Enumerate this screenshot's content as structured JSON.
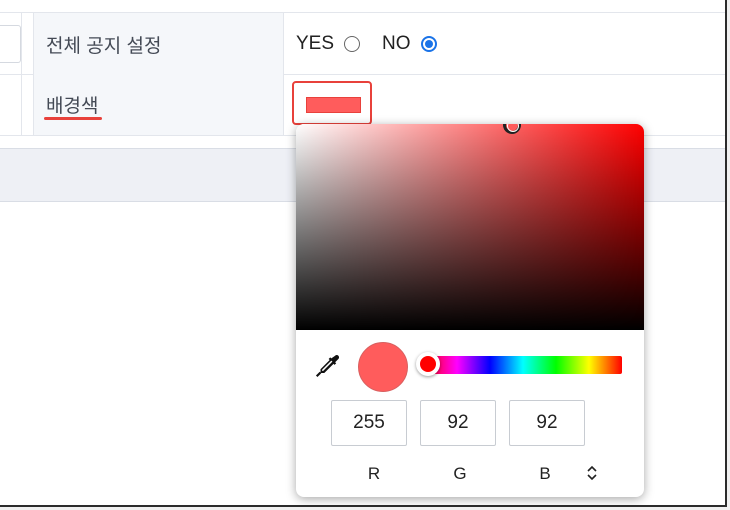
{
  "settings": {
    "row1": {
      "label": "전체 공지 설정",
      "options": [
        {
          "label": "YES",
          "checked": false
        },
        {
          "label": "NO",
          "checked": true
        }
      ]
    },
    "row2": {
      "label": "배경색",
      "swatch_color": "#ff5c5c"
    }
  },
  "color_picker": {
    "hue_color": "#ff0000",
    "selected_color": "#ff5c5c",
    "eyedropper_icon": "eyedropper-icon",
    "mode_toggle_icon": "chevron-up-down-icon",
    "channels": [
      {
        "label": "R",
        "value": "255"
      },
      {
        "label": "G",
        "value": "92"
      },
      {
        "label": "B",
        "value": "92"
      }
    ]
  },
  "colors": {
    "accent": "#1a73e8",
    "highlight": "#e8413b"
  }
}
